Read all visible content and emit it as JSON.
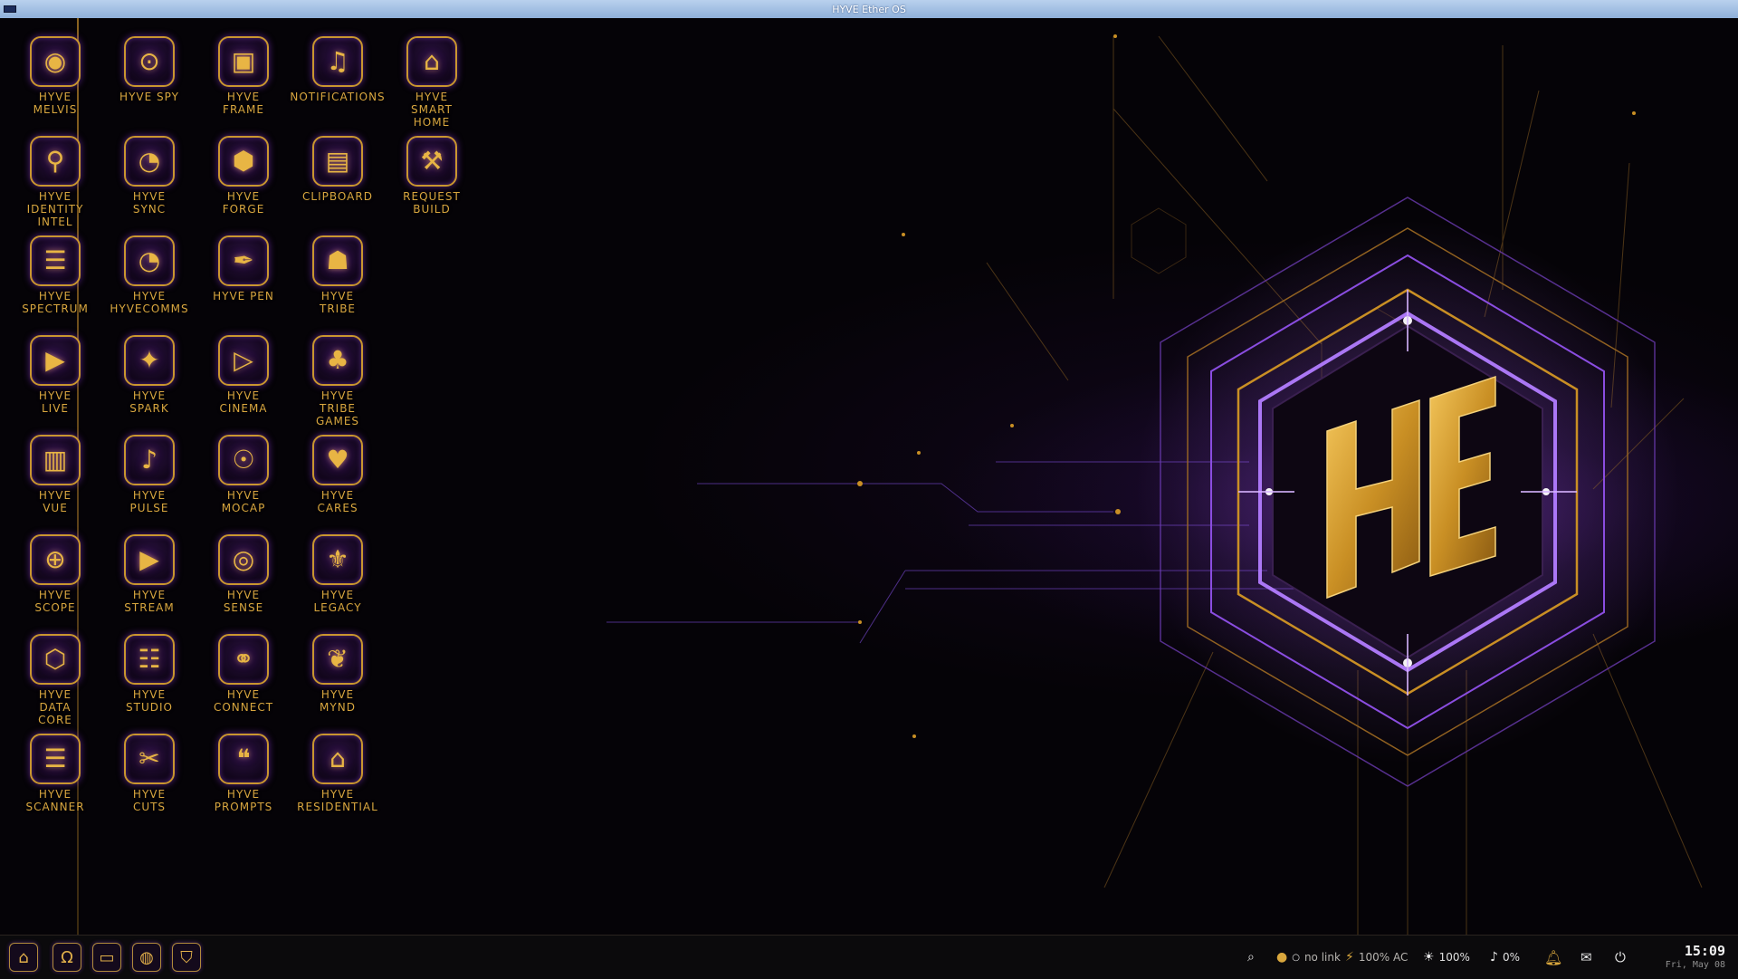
{
  "window": {
    "title": "HYVE Ether OS"
  },
  "apps": [
    {
      "label": "HYVE\nMELVIS",
      "icon": "eye-shield-icon",
      "glyph": "◉"
    },
    {
      "label": "HYVE SPY",
      "icon": "spy-eye-icon",
      "glyph": "⊙"
    },
    {
      "label": "HYVE\nFRAME",
      "icon": "frame-icon",
      "glyph": "▣"
    },
    {
      "label": "NOTIFICATIONS",
      "icon": "bell-icon",
      "glyph": "♫"
    },
    {
      "label": "HYVE\nSMART\nHOME",
      "icon": "smart-home-icon",
      "glyph": "⌂"
    },
    {
      "label": "HYVE\nIDENTITY\nINTEL",
      "icon": "identity-search-icon",
      "glyph": "⚲"
    },
    {
      "label": "HYVE\nSYNC",
      "icon": "satellite-dish-icon",
      "glyph": "◔"
    },
    {
      "label": "HYVE\nFORGE",
      "icon": "cube-icon",
      "glyph": "⬢"
    },
    {
      "label": "CLIPBOARD",
      "icon": "clipboard-icon",
      "glyph": "▤"
    },
    {
      "label": "REQUEST\nBUILD",
      "icon": "build-request-icon",
      "glyph": "⚒"
    },
    {
      "label": "HYVE\nSPECTRUM",
      "icon": "spectrum-icon",
      "glyph": "☰"
    },
    {
      "label": "HYVE\nHYVECOMMS",
      "icon": "comms-dish-icon",
      "glyph": "◔"
    },
    {
      "label": "HYVE PEN",
      "icon": "pen-nib-icon",
      "glyph": "✒"
    },
    {
      "label": "HYVE\nTRIBE",
      "icon": "tribe-people-icon",
      "glyph": "☗"
    },
    {
      "label": "HYVE\nLIVE",
      "icon": "live-play-icon",
      "glyph": "▶"
    },
    {
      "label": "HYVE\nSPARK",
      "icon": "spark-icon",
      "glyph": "✦"
    },
    {
      "label": "HYVE\nCINEMA",
      "icon": "cinema-play-icon",
      "glyph": "▷"
    },
    {
      "label": "HYVE\nTRIBE\nGAMES",
      "icon": "gamepad-icon",
      "glyph": "♣"
    },
    {
      "label": "HYVE\nVUE",
      "icon": "city-vue-icon",
      "glyph": "▥"
    },
    {
      "label": "HYVE\nPULSE",
      "icon": "music-pulse-icon",
      "glyph": "♪"
    },
    {
      "label": "HYVE\nMOCAP",
      "icon": "mocap-figure-icon",
      "glyph": "☉"
    },
    {
      "label": "HYVE\nCARES",
      "icon": "heart-care-icon",
      "glyph": "♥"
    },
    {
      "label": "HYVE\nSCOPE",
      "icon": "crosshair-scope-icon",
      "glyph": "⊕"
    },
    {
      "label": "HYVE\nSTREAM",
      "icon": "stream-play-icon",
      "glyph": "▶"
    },
    {
      "label": "HYVE\nSENSE",
      "icon": "sense-radar-icon",
      "glyph": "◎"
    },
    {
      "label": "HYVE\nLEGACY",
      "icon": "legacy-crest-icon",
      "glyph": "⚜"
    },
    {
      "label": "HYVE\nDATA\nCORE",
      "icon": "data-core-icon",
      "glyph": "⬡"
    },
    {
      "label": "HYVE\nSTUDIO",
      "icon": "mixer-studio-icon",
      "glyph": "☷"
    },
    {
      "label": "HYVE\nCONNECT",
      "icon": "chain-link-icon",
      "glyph": "⚭"
    },
    {
      "label": "HYVE\nMYND",
      "icon": "brain-heart-icon",
      "glyph": "❦"
    },
    {
      "label": "HYVE\nSCANNER",
      "icon": "barcode-scanner-icon",
      "glyph": "☰"
    },
    {
      "label": "HYVE\nCUTS",
      "icon": "scissors-icon",
      "glyph": "✂"
    },
    {
      "label": "HYVE\nPROMPTS",
      "icon": "quote-icon",
      "glyph": "❝"
    },
    {
      "label": "HYVE\nRESIDENTIAL",
      "icon": "residential-home-icon",
      "glyph": "⌂"
    }
  ],
  "taskbar": {
    "launchers": [
      {
        "name": "home-launcher",
        "icon": "home-icon",
        "glyph": "⌂"
      },
      {
        "name": "omega-launcher",
        "icon": "omega-icon",
        "glyph": "Ω"
      },
      {
        "name": "files-launcher",
        "icon": "folder-icon",
        "glyph": "▭"
      },
      {
        "name": "globe-launcher",
        "icon": "globe-icon",
        "glyph": "◍"
      },
      {
        "name": "shield-launcher",
        "icon": "shield-icon",
        "glyph": "⛉"
      }
    ],
    "tray": {
      "search_icon": "⌕",
      "network_label": "no link",
      "battery_label": "100% AC",
      "brightness_label": "100%",
      "volume_label": "0%"
    },
    "clock": {
      "time": "15:09",
      "date": "Fri, May 08"
    }
  },
  "theme": {
    "accent_gold": "#d8a63f",
    "accent_purple": "#8a3ce6",
    "background": "#050307"
  }
}
